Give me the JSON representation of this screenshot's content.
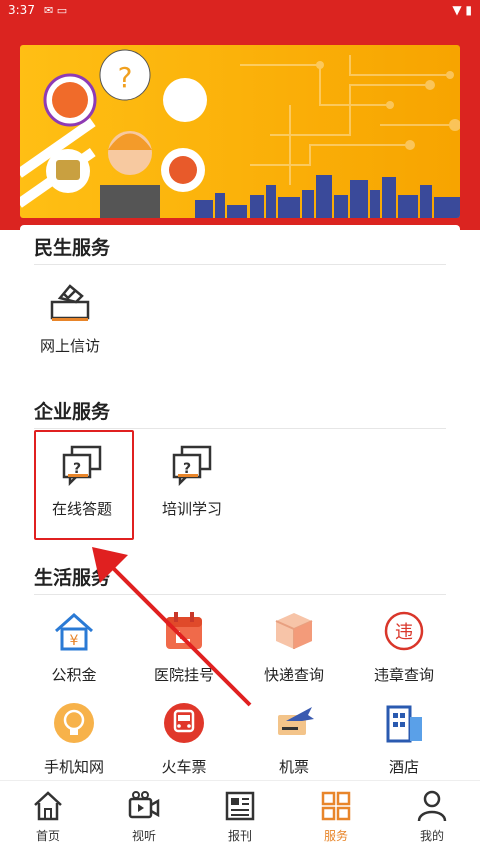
{
  "status_bar": {
    "time": "3:37"
  },
  "sections": {
    "minsheng": {
      "title": "民生服务",
      "items": [
        {
          "label": "网上信访"
        }
      ]
    },
    "qiye": {
      "title": "企业服务",
      "items": [
        {
          "label": "在线答题"
        },
        {
          "label": "培训学习"
        }
      ]
    },
    "shenghuo": {
      "title": "生活服务",
      "items": [
        {
          "label": "公积金"
        },
        {
          "label": "医院挂号"
        },
        {
          "label": "快递查询"
        },
        {
          "label": "违章查询"
        },
        {
          "label": "手机知网"
        },
        {
          "label": "火车票"
        },
        {
          "label": "机票"
        },
        {
          "label": "酒店"
        }
      ]
    }
  },
  "nav": [
    {
      "label": "首页"
    },
    {
      "label": "视听"
    },
    {
      "label": "报刊"
    },
    {
      "label": "服务"
    },
    {
      "label": "我的"
    }
  ],
  "colors": {
    "brand_red": "#db2420",
    "active_orange": "#e8852a"
  },
  "icons": {
    "wei_glyph": "违"
  }
}
